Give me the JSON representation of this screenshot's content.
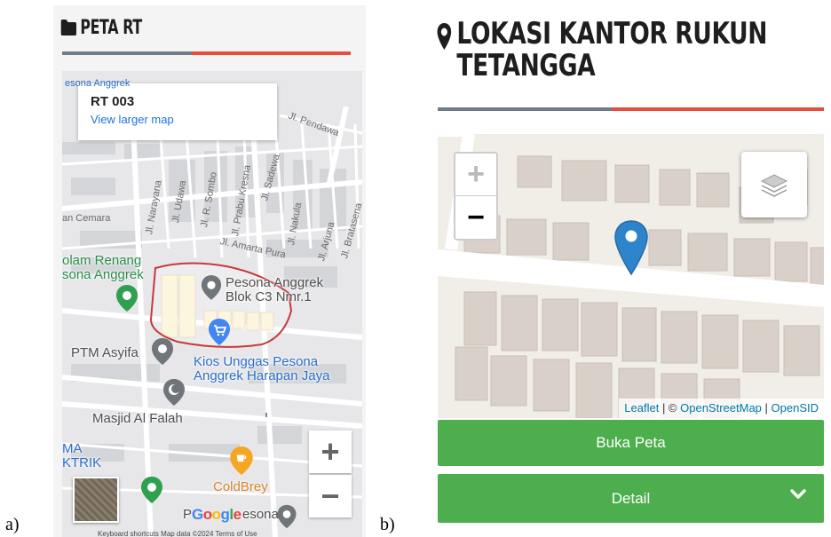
{
  "labels": {
    "a": "a)",
    "b": "b)"
  },
  "panel_a": {
    "title": "PETA RT",
    "title_icon": "folder-icon",
    "map": {
      "info_card": {
        "title": "RT 003",
        "link": "View larger map"
      },
      "streets": [
        "Jl. Pendawa",
        "Jl. Narayana",
        "Jl. Udawa",
        "Jl. R. Sombo",
        "Jl. Prabu Kresna",
        "Jl. Sadewa",
        "Jl. Nakula",
        "Jl. Arjuna",
        "Jl. Bratasena",
        "Jl. Amarta Pura",
        "an Cemara",
        "esona Anggrek"
      ],
      "pois": {
        "kolam": "olam Renang\nsona Anggrek",
        "pesona_blok": "Pesona Anggrek\nBlok C3 Nmr.1",
        "ptm": "PTM Asyifa",
        "kios": "Kios Unggas Pesona\nAnggrek Harapan Jaya",
        "masjid": "Masjid Al Falah",
        "ma": "MA\nKTRIK",
        "coldbrey": "ColdBrey",
        "pesona_bottom": "P",
        "pesona_bottom_2": "esona"
      },
      "google_logo": "Google",
      "footer": "Keyboard shortcuts   Map data ©2024   Terms of Use",
      "zoom_in": "+",
      "zoom_out": "−"
    }
  },
  "panel_b": {
    "title": "LOKASI KANTOR RUKUN TETANGGA",
    "title_icon": "map-marker-icon",
    "map": {
      "zoom_in": "+",
      "zoom_out": "−",
      "attribution": {
        "leaflet": "Leaflet",
        "sep1": " | © ",
        "osm": "OpenStreetMap",
        "sep2": " | ",
        "opensid": "OpenSID"
      }
    },
    "buttons": {
      "open_map": "Buka Peta",
      "detail": "Detail"
    }
  },
  "colors": {
    "accent_red": "#e84c3d",
    "divider_gray": "#6f7b86",
    "button_green": "#4cae4c",
    "link_blue": "#1a73e8",
    "leaflet_link": "#0078a8"
  }
}
